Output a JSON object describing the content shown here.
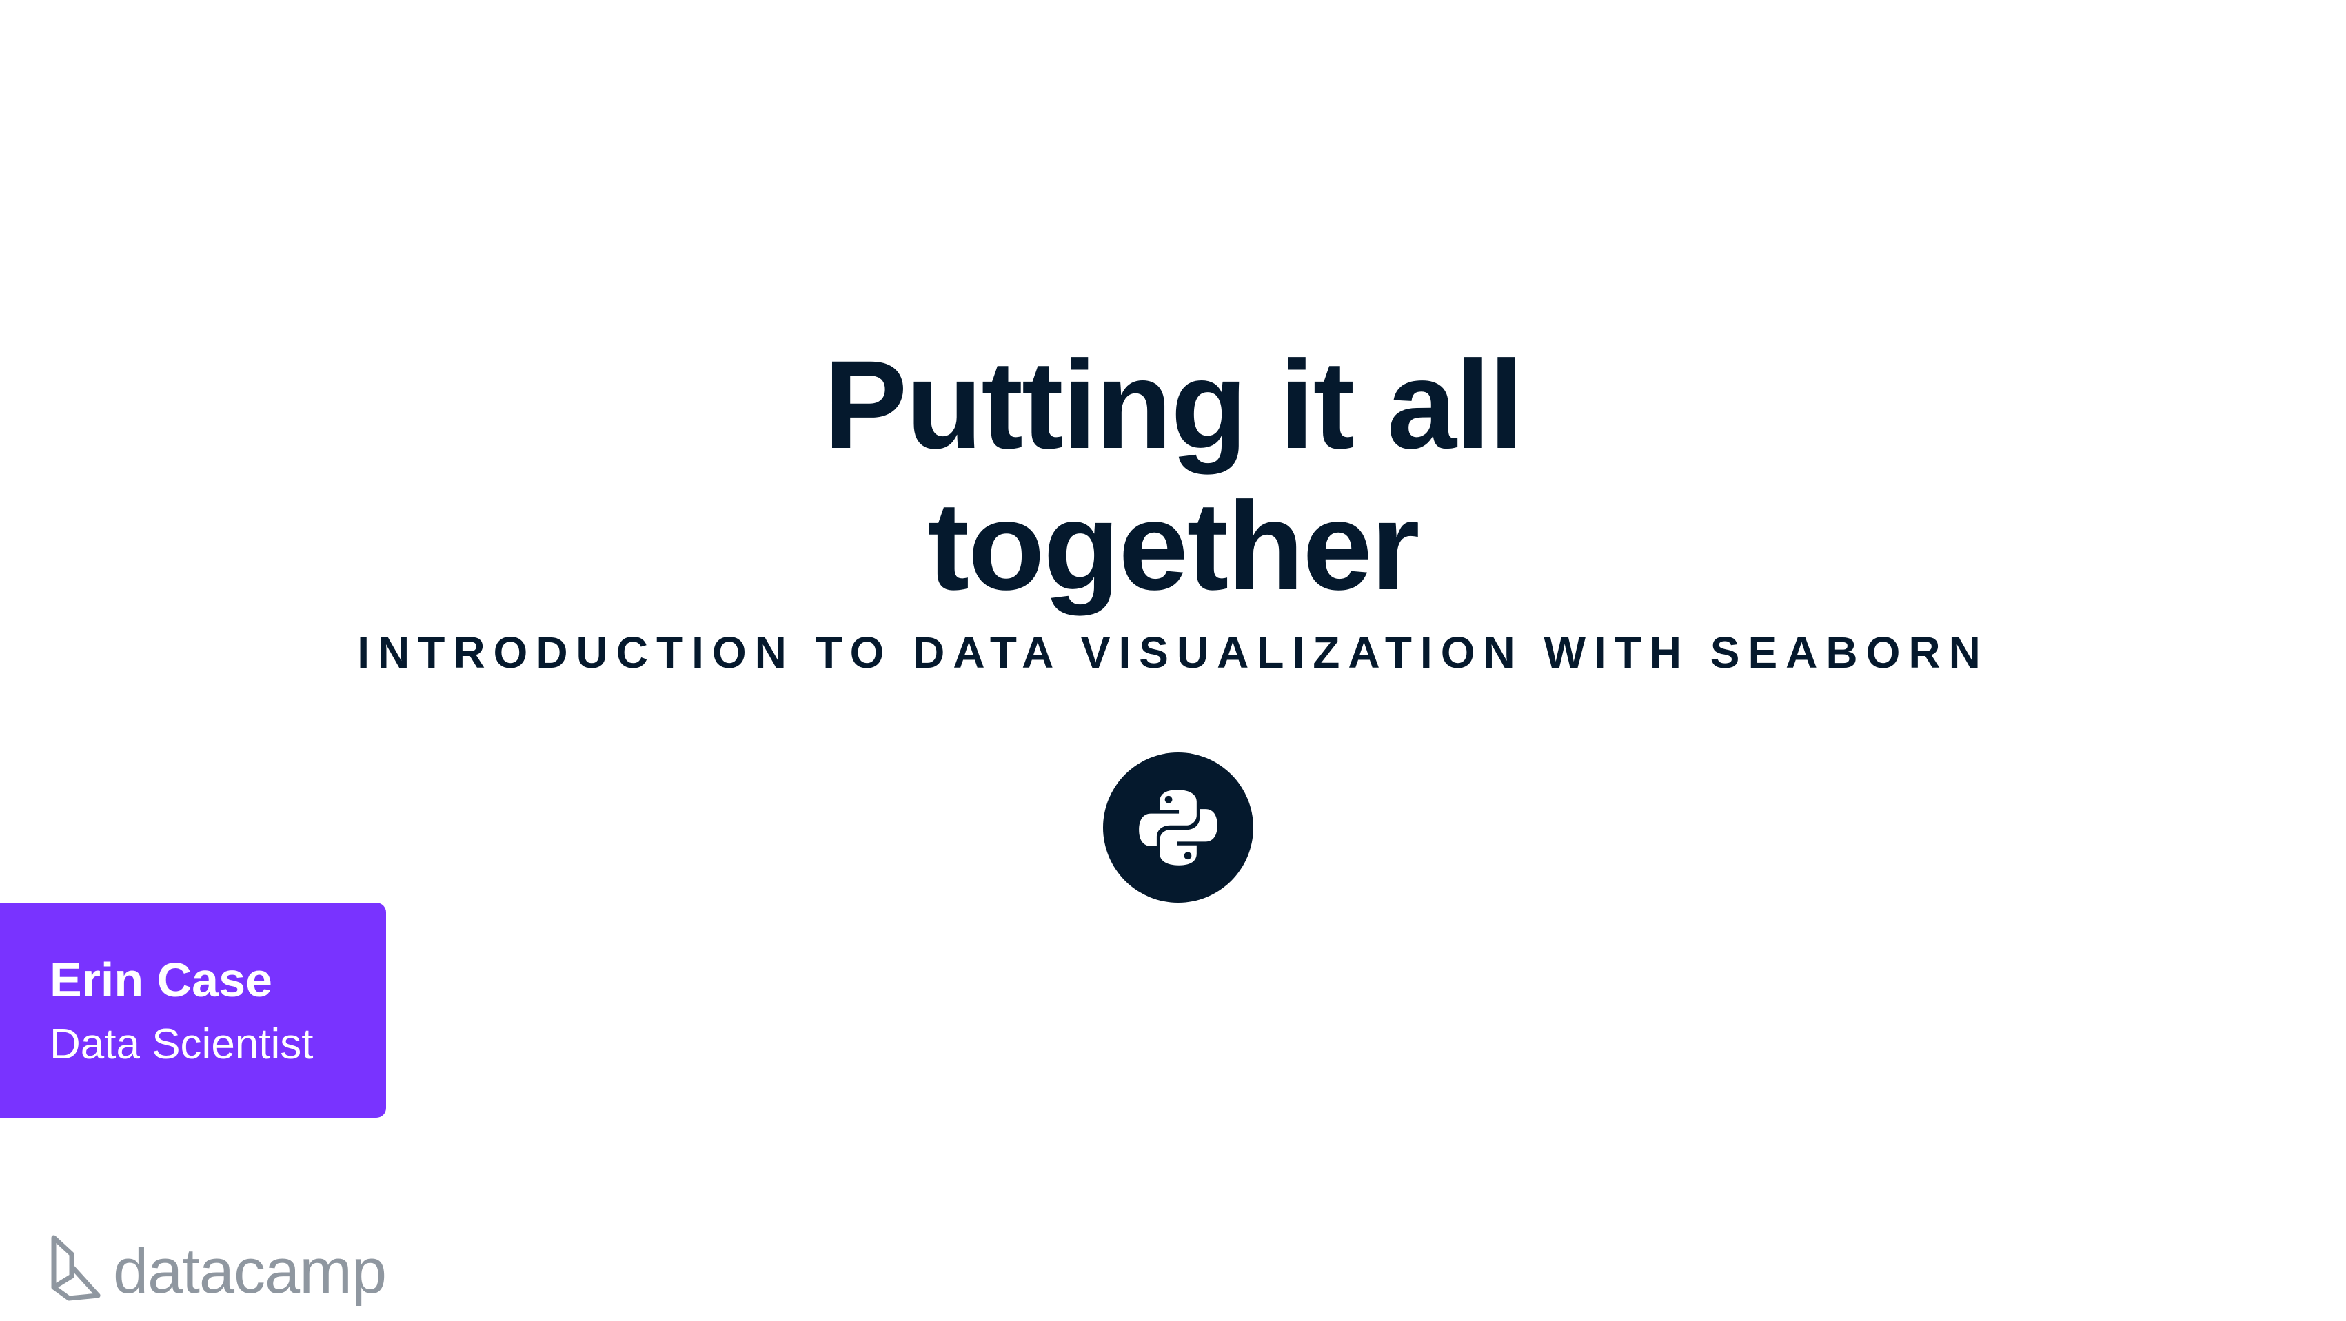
{
  "slide": {
    "title_line1": "Putting it all",
    "title_line2": "together",
    "course": "INTRODUCTION TO DATA VISUALIZATION WITH SEABORN",
    "badge_icon": "python-logo-icon"
  },
  "author": {
    "name": "Erin Case",
    "role": "Data Scientist",
    "card_color": "#7933ff"
  },
  "brand": {
    "name": "datacamp",
    "icon": "datacamp-logo-icon"
  },
  "colors": {
    "text": "#05192d",
    "background": "#ffffff",
    "brand_gray": "#8f97a0"
  }
}
